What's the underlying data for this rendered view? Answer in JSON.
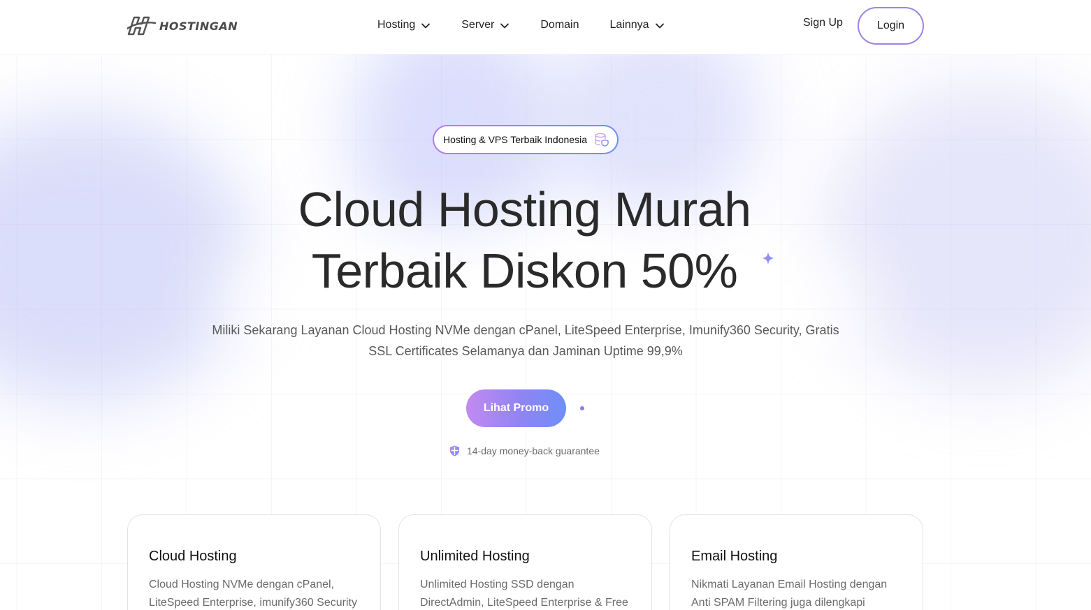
{
  "header": {
    "logo_text": "HOSTINGAN",
    "nav": [
      {
        "label": "Hosting",
        "dropdown": true
      },
      {
        "label": "Server",
        "dropdown": true
      },
      {
        "label": "Domain",
        "dropdown": false
      },
      {
        "label": "Lainnya",
        "dropdown": true
      }
    ],
    "signup_label": "Sign Up",
    "login_label": "Login"
  },
  "hero": {
    "badge_text": "Hosting & VPS Terbaik Indonesia",
    "title_line1": "Cloud Hosting Murah",
    "title_line2": "Terbaik Diskon 50%",
    "subtitle": "Miliki Sekarang Layanan Cloud Hosting NVMe dengan cPanel, LiteSpeed Enterprise, Imunify360 Security, Gratis SSL Certificates Selamanya dan Jaminan Uptime 99,9%",
    "cta_label": "Lihat Promo",
    "guarantee": "14-day money-back guarantee"
  },
  "cards": [
    {
      "title": "Cloud Hosting",
      "desc": "Cloud Hosting NVMe dengan cPanel, LiteSpeed Enterprise, imunify360 Security"
    },
    {
      "title": "Unlimited Hosting",
      "desc": "Unlimited Hosting SSD dengan DirectAdmin, LiteSpeed Enterprise & Free"
    },
    {
      "title": "Email Hosting",
      "desc": "Nikmati Layanan Email Hosting dengan Anti SPAM Filtering juga dilengkapi"
    }
  ],
  "colors": {
    "accent_purple": "#9b84e6",
    "accent_blue": "#6f8ff7",
    "text_dark": "#2a2a2a",
    "text_muted": "#595959"
  },
  "icons": {
    "logo": "hostingan-h-logo",
    "chevron": "chevron-down-icon",
    "badge": "database-shield-icon",
    "sparkle": "sparkle-icon",
    "guarantee": "shield-icon"
  }
}
